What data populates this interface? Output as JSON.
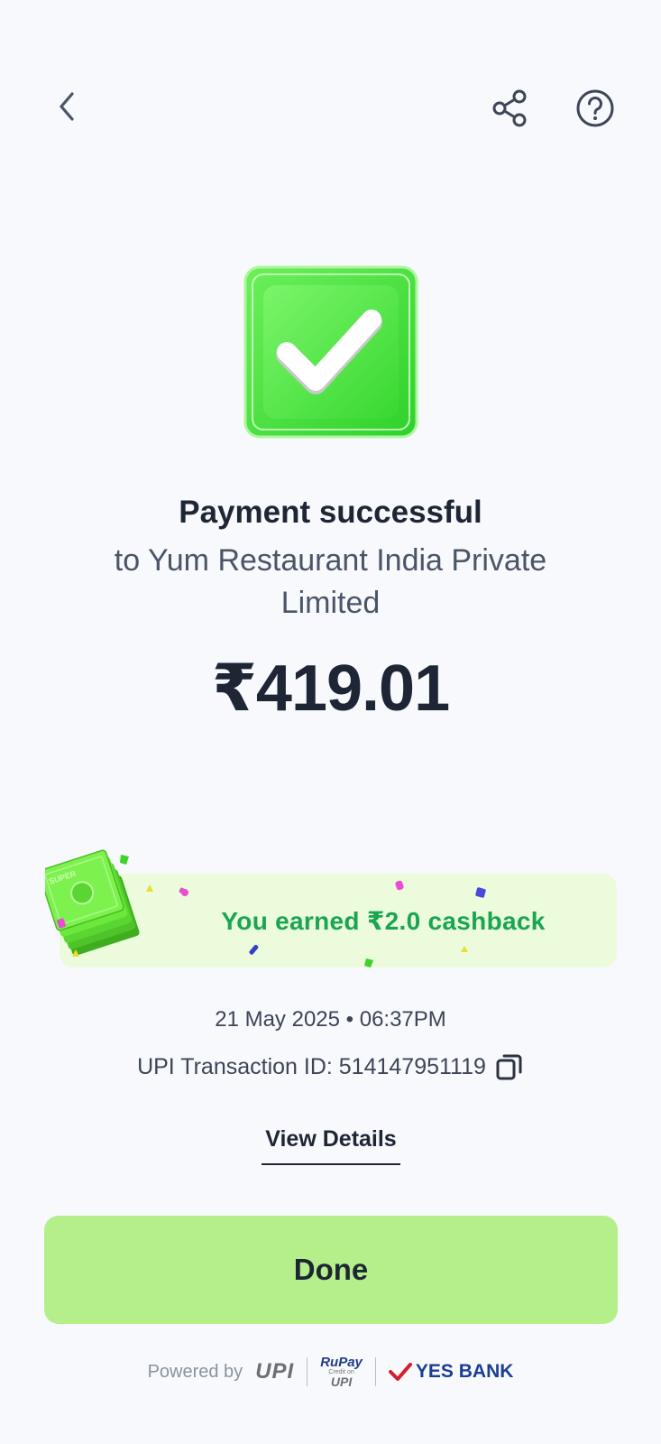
{
  "header": {
    "back_icon": "chevron-left-icon",
    "share_icon": "share-icon",
    "help_icon": "help-circle-icon"
  },
  "status": {
    "title": "Payment successful",
    "recipient": "to Yum Restaurant India Private Limited",
    "amount": "₹419.01"
  },
  "cashback": {
    "text": "You earned ₹2.0 cashback",
    "badge_text": "SUPER"
  },
  "transaction": {
    "datetime": "21 May 2025 • 06:37PM",
    "upi_id_label": "UPI Transaction ID: 514147951119"
  },
  "actions": {
    "view_details": "View Details",
    "done": "Done"
  },
  "footer": {
    "powered_by": "Powered by",
    "upi": "UPI",
    "rupay": "RuPay",
    "rupay_credit": "Credit on",
    "rupay_upi": "UPI",
    "bank": "YES BANK"
  },
  "colors": {
    "accent_green": "#1aa552",
    "done_bg": "#b5ef8a",
    "banner_bg": "#ebfbdb",
    "text_dark": "#1e2636"
  }
}
